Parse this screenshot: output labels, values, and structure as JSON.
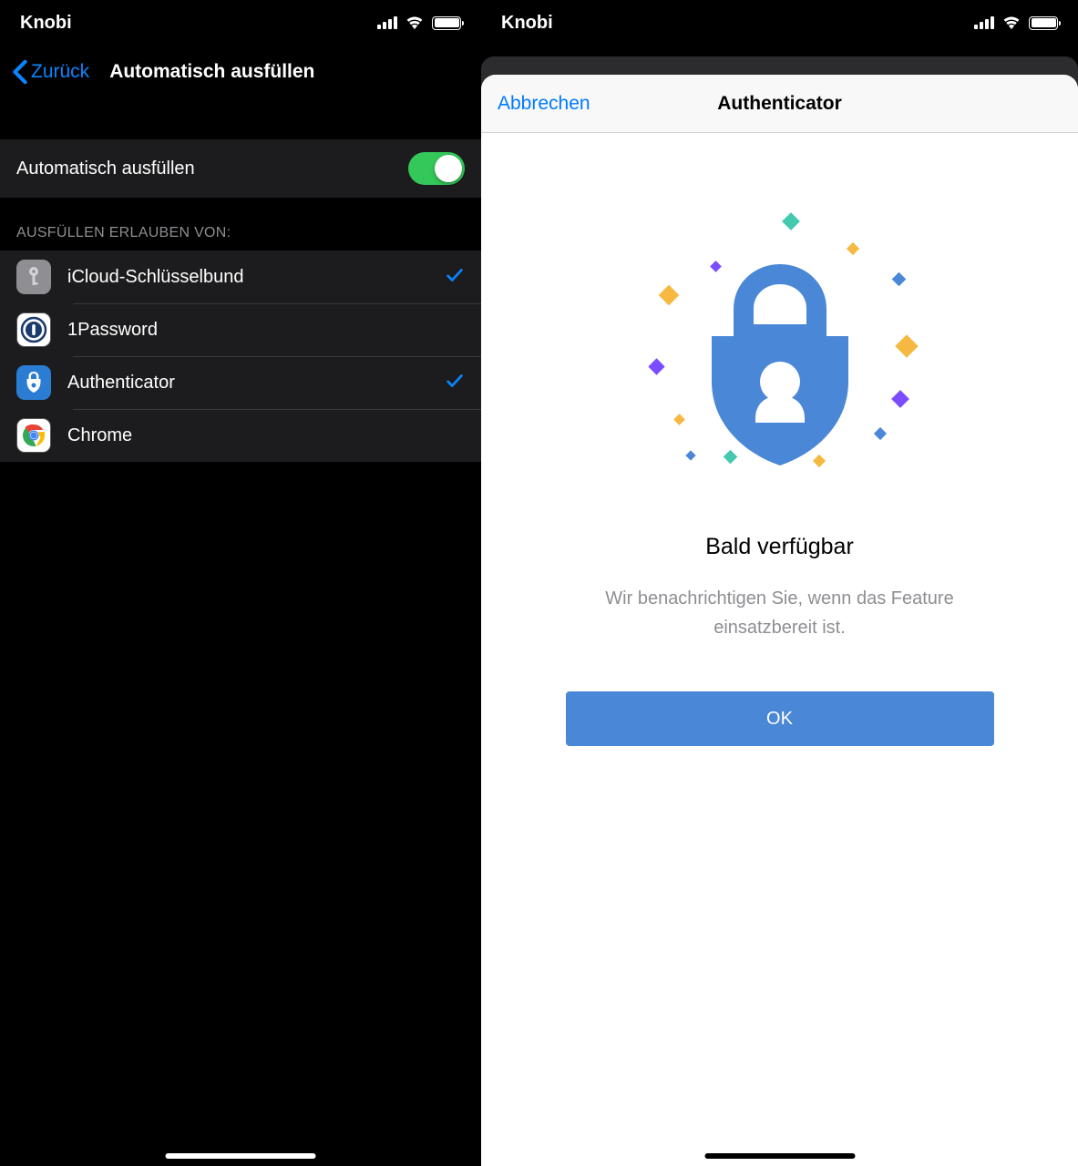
{
  "leftPhone": {
    "statusbar": {
      "carrier": "Knobi"
    },
    "nav": {
      "back": "Zurück",
      "title": "Automatisch ausfüllen"
    },
    "toggle": {
      "label": "Automatisch ausfüllen"
    },
    "sectionHeader": "AUSFÜLLEN ERLAUBEN VON:",
    "apps": [
      {
        "name": "iCloud-Schlüsselbund",
        "checked": true,
        "icon": "icloud"
      },
      {
        "name": "1Password",
        "checked": false,
        "icon": "1password"
      },
      {
        "name": "Authenticator",
        "checked": true,
        "icon": "auth"
      },
      {
        "name": "Chrome",
        "checked": false,
        "icon": "chrome"
      }
    ]
  },
  "rightPhone": {
    "statusbar": {
      "carrier": "Knobi"
    },
    "modal": {
      "cancel": "Abbrechen",
      "title": "Authenticator",
      "heading": "Bald verfügbar",
      "subtitle": "Wir benachrichtigen Sie, wenn das Feature einsatzbereit ist.",
      "button": "OK"
    }
  }
}
